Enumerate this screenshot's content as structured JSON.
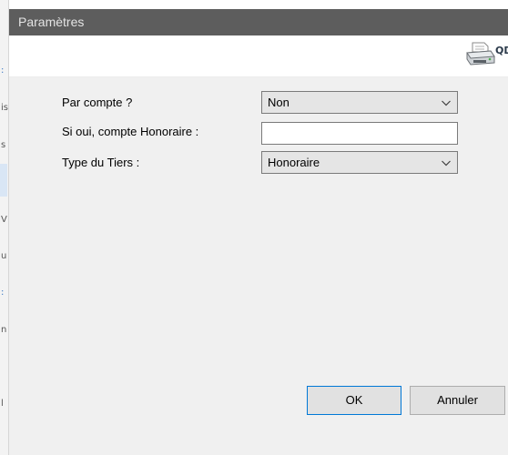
{
  "dialog": {
    "title": "Paramètres"
  },
  "toolbar": {
    "print_icon": "printer-icon",
    "print_label": "QD"
  },
  "form": {
    "par_compte": {
      "label": "Par compte ?",
      "value": "Non"
    },
    "compte_honoraire": {
      "label": "Si oui, compte Honoraire :",
      "value": ""
    },
    "type_tiers": {
      "label": "Type du Tiers :",
      "value": "Honoraire"
    }
  },
  "buttons": {
    "ok": "OK",
    "cancel": "Annuler"
  },
  "background_window": {
    "visible_chars": [
      ":",
      "is",
      "s",
      "V",
      "u",
      ":",
      "n",
      "l"
    ]
  },
  "colors": {
    "titlebar": "#5d5d5d",
    "content_bg": "#f0f0f0",
    "ok_border": "#0078d7"
  }
}
